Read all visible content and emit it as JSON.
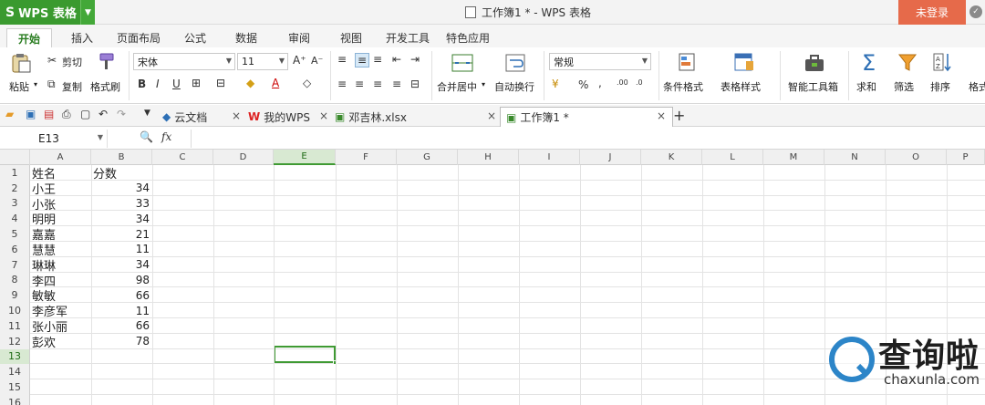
{
  "titlebar": {
    "app_button": "WPS 表格",
    "document_title": "工作簿1 * - WPS 表格",
    "login_button": "未登录"
  },
  "ribbon_tabs": [
    "开始",
    "插入",
    "页面布局",
    "公式",
    "数据",
    "审阅",
    "视图",
    "开发工具",
    "特色应用"
  ],
  "ribbon": {
    "paste": "粘贴",
    "cut": "剪切",
    "copy": "复制",
    "format_painter": "格式刷",
    "font_name": "宋体",
    "font_size": "11",
    "bold": "B",
    "italic": "I",
    "underline": "U",
    "merge_center": "合并居中",
    "wrap_text": "自动换行",
    "number_format": "常规",
    "percent": "%",
    "thousands": ",",
    "inc_decimal": ".00",
    "conditional_format": "条件格式",
    "table_style": "表格样式",
    "smart_toolbox": "智能工具箱",
    "sum": "求和",
    "filter": "筛选",
    "sort": "排序",
    "format": "格式"
  },
  "doc_tabs": {
    "cloud_docs": "云文档",
    "my_wps": "我的WPS",
    "file_xlsx": "邓吉林.xlsx",
    "workbook": "工作簿1 *",
    "add_tab": "+"
  },
  "formula_bar": {
    "cell_ref": "E13",
    "fx": "fx"
  },
  "columns": [
    "A",
    "B",
    "C",
    "D",
    "E",
    "F",
    "G",
    "H",
    "I",
    "J",
    "K",
    "L",
    "M",
    "N",
    "O",
    "P"
  ],
  "selected_column": "E",
  "selected_row": 13,
  "table": {
    "headers": [
      "姓名",
      "分数"
    ],
    "rows": [
      [
        "小王",
        "34"
      ],
      [
        "小张",
        "33"
      ],
      [
        "明明",
        "34"
      ],
      [
        "嘉嘉",
        "21"
      ],
      [
        "慧慧",
        "11"
      ],
      [
        "琳琳",
        "34"
      ],
      [
        "李四",
        "98"
      ],
      [
        "敏敏",
        "66"
      ],
      [
        "李彦军",
        "11"
      ],
      [
        "张小丽",
        "66"
      ],
      [
        "彭欢",
        "78"
      ]
    ]
  },
  "row_numbers": [
    "1",
    "2",
    "3",
    "4",
    "5",
    "6",
    "7",
    "8",
    "9",
    "10",
    "11",
    "12",
    "13",
    "14",
    "15",
    "16"
  ],
  "watermark": {
    "title": "查询啦",
    "domain": "chaxunla.com"
  },
  "colors": {
    "wps_green": "#3a9a2f",
    "login_red": "#e66a4a",
    "selection_green": "#3f9a33",
    "watermark_blue": "#2c85c8"
  }
}
